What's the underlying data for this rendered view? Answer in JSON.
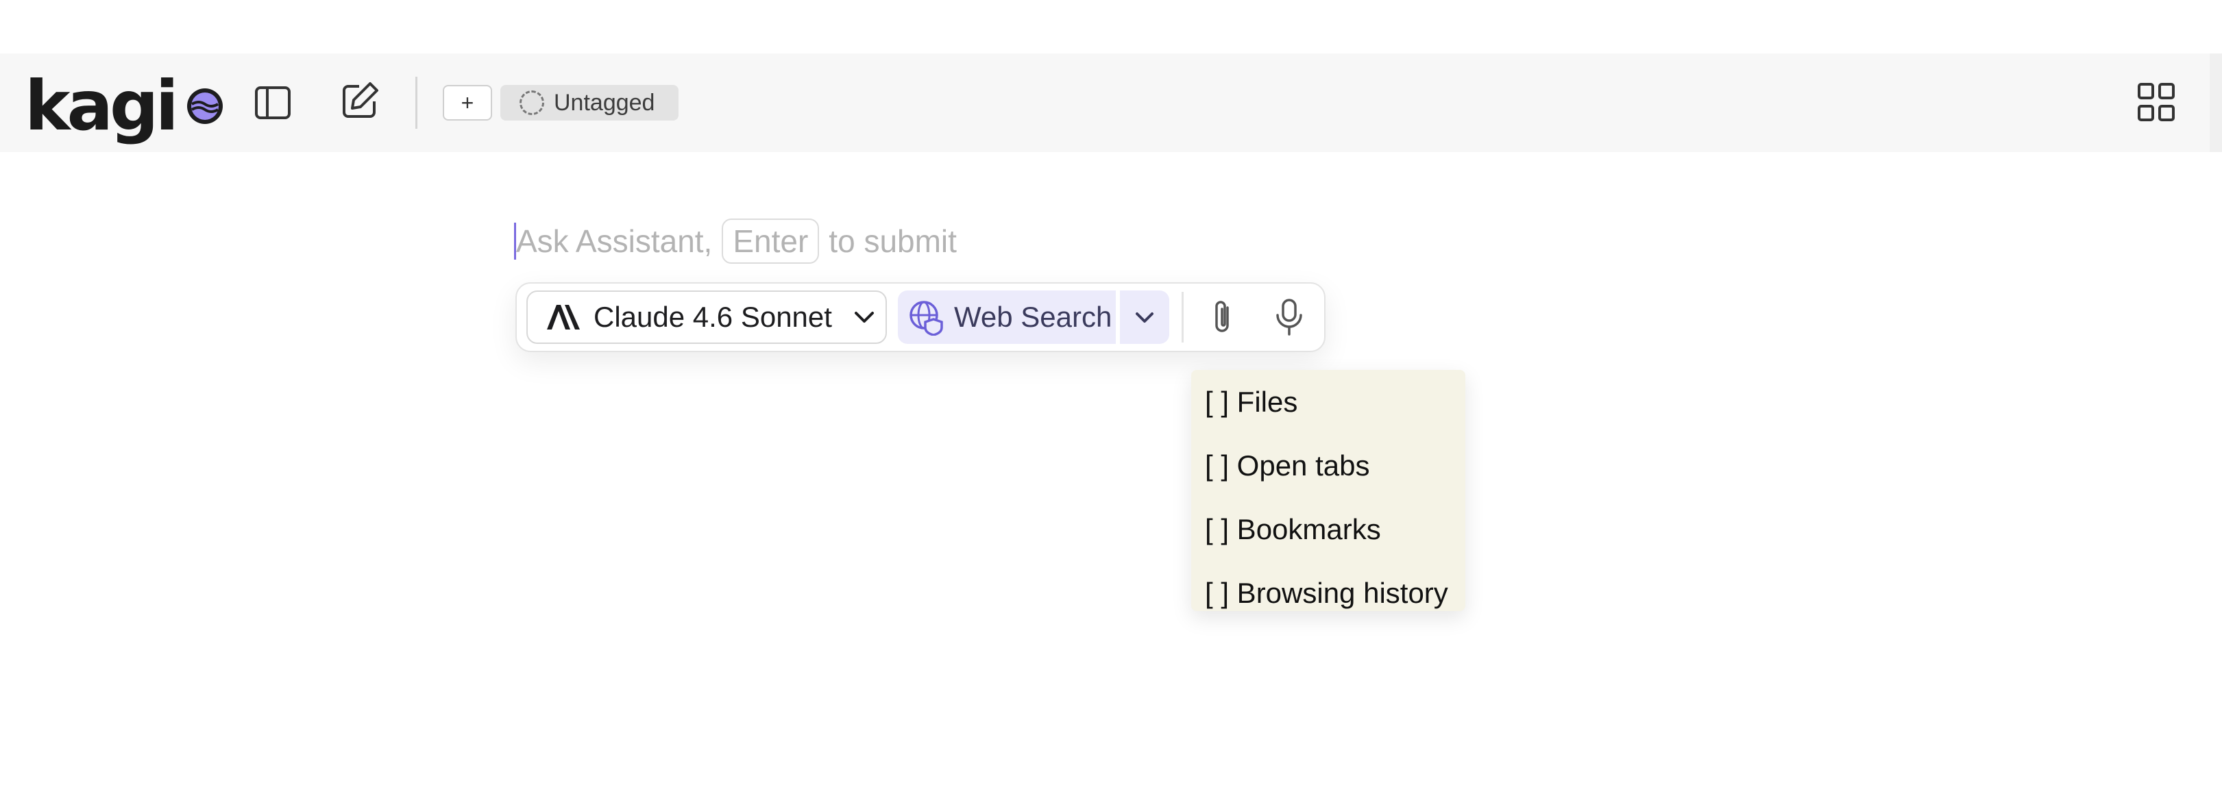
{
  "header": {
    "logo_text": "kagi",
    "toggle_sidebar_icon": "sidebar-toggle-icon",
    "new_chat_icon": "edit-icon",
    "add_tag_label": "+",
    "tag_label": "Untagged",
    "apps_icon": "grid-icon"
  },
  "composer": {
    "placeholder_start": "Ask Assistant,",
    "placeholder_key": "Enter",
    "placeholder_end": "to submit",
    "model_label": "Claude 4.6 Sonnet",
    "web_search_label": "Web Search",
    "attach_icon": "paperclip-icon",
    "mic_icon": "microphone-icon"
  },
  "dropdown": {
    "items": [
      {
        "label": "[ ] Files"
      },
      {
        "label": "[ ] Open tabs"
      },
      {
        "label": "[ ] Bookmarks"
      },
      {
        "label": "[ ] Browsing history"
      }
    ]
  },
  "colors": {
    "accent": "#6b5fd8",
    "web_search_bg": "#ecebfb",
    "dropdown_bg": "#f5f3e6",
    "toolbar_bg": "#f7f7f7"
  }
}
